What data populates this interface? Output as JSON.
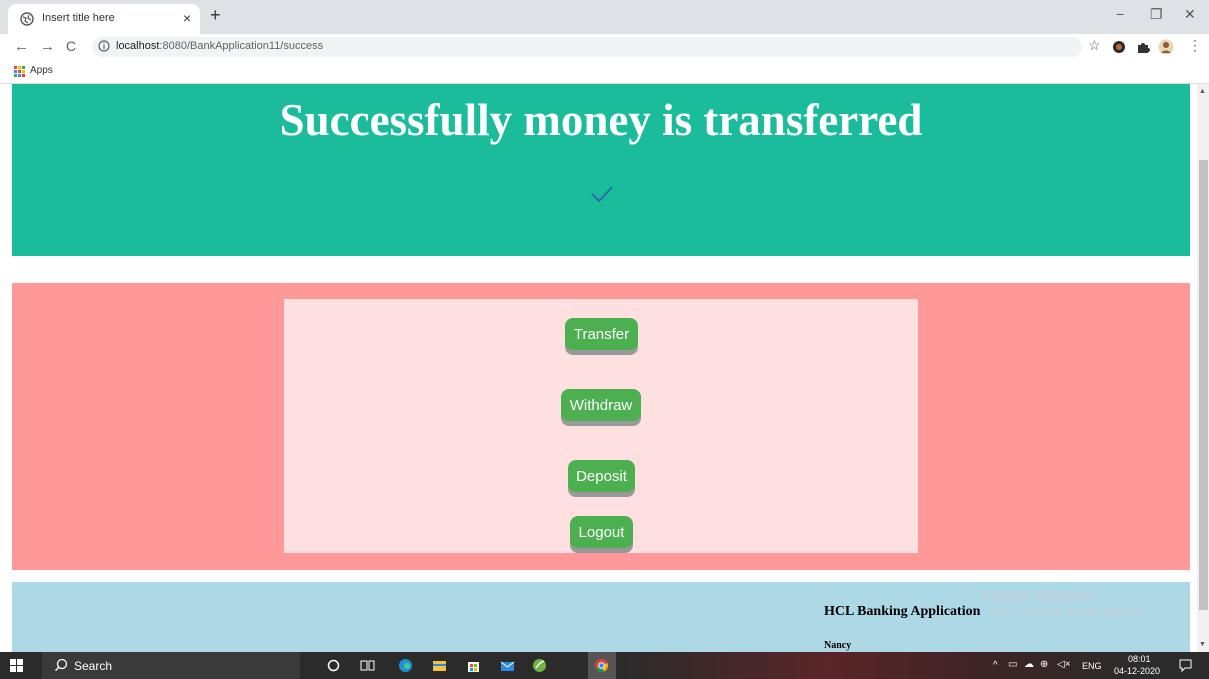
{
  "browser": {
    "tab_title": "Insert title here",
    "url_host": "localhost",
    "url_path": ":8080/BankApplication11/success",
    "bookmark_apps": "Apps"
  },
  "page": {
    "title": "Successfully money is transferred",
    "buttons": {
      "transfer": "Transfer",
      "withdraw": "Withdraw",
      "deposit": "Deposit",
      "logout": "Logout"
    },
    "footer": {
      "title": "HCL Banking Application",
      "user": "Nancy"
    }
  },
  "watermark": {
    "line1": "Activate Windows",
    "line2": "Go to Settings to activate Windows."
  },
  "taskbar": {
    "search_label": "Search",
    "lang": "ENG",
    "time": "08:01",
    "date": "04-12-2020"
  },
  "colors": {
    "header_band": "#1abc9c",
    "menu_band": "#ff9999",
    "menu_box": "#ffe0e0",
    "button": "#4caf50",
    "footer_band": "#add8e6"
  }
}
